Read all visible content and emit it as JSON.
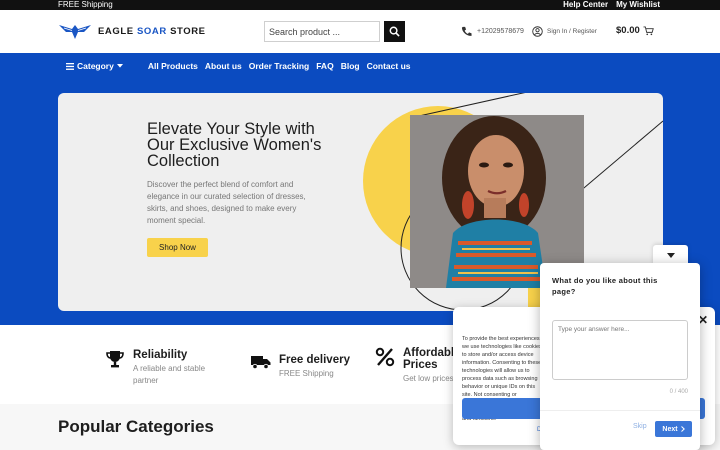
{
  "topbar": {
    "left_text": "FREE Shipping",
    "links": [
      "Help Center",
      "My Wishlist"
    ]
  },
  "header": {
    "logo": {
      "part1": "EAGLE ",
      "part2": "SOAR",
      "part3": " STORE"
    },
    "search": {
      "placeholder": "Search product ...",
      "value": ""
    },
    "phone": "+12029578679",
    "account": "Sign In / Register",
    "cart_total": "$0.00"
  },
  "nav": {
    "category_label": "Category",
    "links": [
      "All Products",
      "About us",
      "Order Tracking",
      "FAQ",
      "Blog",
      "Contact us"
    ]
  },
  "hero": {
    "title": "Elevate Your Style with Our Exclusive Women's Collection",
    "description": "Discover the perfect blend of comfort and elegance in our curated selection of dresses, skirts, and shoes, designed to make every moment special.",
    "button": "Shop Now"
  },
  "features": [
    {
      "icon": "trophy-icon",
      "title": "Reliability",
      "subtitle": "A reliable and stable partner"
    },
    {
      "icon": "truck-icon",
      "title": "Free delivery",
      "subtitle": "FREE Shipping"
    },
    {
      "icon": "percent-icon",
      "title": "Affordable Prices",
      "subtitle": "Get low prices"
    }
  ],
  "popular": {
    "title": "Popular Categories"
  },
  "cookie": {
    "text": "To provide the best experiences, we use technologies like cookies to store and/or access device information. Consenting to these technologies will allow us to process data such as browsing behavior or unique IDs on this site. Not consenting or withdrawing consent, may adversely affect certain features and functions.",
    "tail": "r",
    "link": "D"
  },
  "survey": {
    "question": "What do you like about this page?",
    "answer_placeholder": "Type your answer here...",
    "answer_value": "",
    "counter": "0 / 400",
    "skip": "Skip",
    "next": "Next"
  },
  "colors": {
    "brand_blue": "#0b4bc0",
    "accent_yellow": "#f8d24b",
    "button_blue": "#3a76d8"
  }
}
